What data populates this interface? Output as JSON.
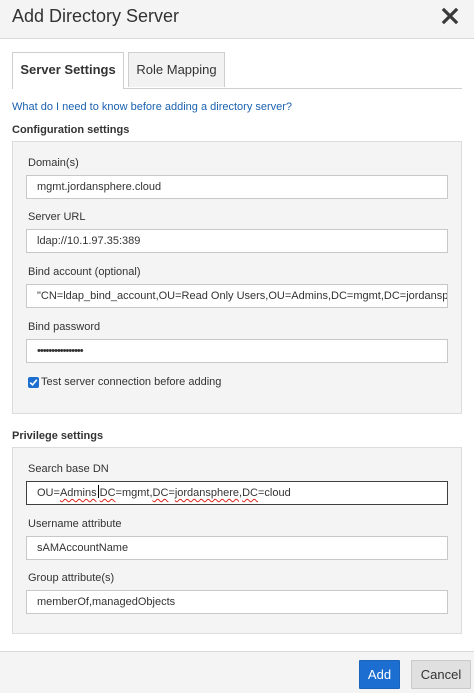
{
  "dialog": {
    "title": "Add Directory Server",
    "close_icon": "close-icon"
  },
  "tabs": [
    {
      "label": "Server Settings",
      "active": true
    },
    {
      "label": "Role Mapping",
      "active": false
    }
  ],
  "help_link": "What do I need to know before adding a directory server?",
  "configuration": {
    "title": "Configuration settings",
    "domains": {
      "label": "Domain(s)",
      "value": "mgmt.jordansphere.cloud"
    },
    "server_url": {
      "label": "Server URL",
      "value": "ldap://10.1.97.35:389"
    },
    "bind_account": {
      "label": "Bind account (optional)",
      "value": "\"CN=ldap_bind_account,OU=Read Only Users,OU=Admins,DC=mgmt,DC=jordansphere,"
    },
    "bind_password": {
      "label": "Bind password",
      "value": "••••••••••••••••"
    },
    "test_connection": {
      "label": "Test server connection before adding",
      "checked": true
    }
  },
  "privilege": {
    "title": "Privilege settings",
    "search_base_dn": {
      "label": "Search base DN",
      "value": "OU=Admins,DC=mgmt,DC=jordansphere,DC=cloud",
      "parts": [
        "OU=",
        "Admins",
        "DC",
        "=mgmt,",
        "DC",
        "=",
        "jordansphere",
        ",",
        "DC",
        "=cloud"
      ]
    },
    "username_attribute": {
      "label": "Username attribute",
      "value": "sAMAccountName"
    },
    "group_attributes": {
      "label": "Group attribute(s)",
      "value": "memberOf,managedObjects"
    }
  },
  "footer": {
    "add_label": "Add",
    "cancel_label": "Cancel"
  },
  "colors": {
    "primary": "#1c6fd1",
    "link": "#1a62b0",
    "panel_bg": "#f4f4f4"
  }
}
